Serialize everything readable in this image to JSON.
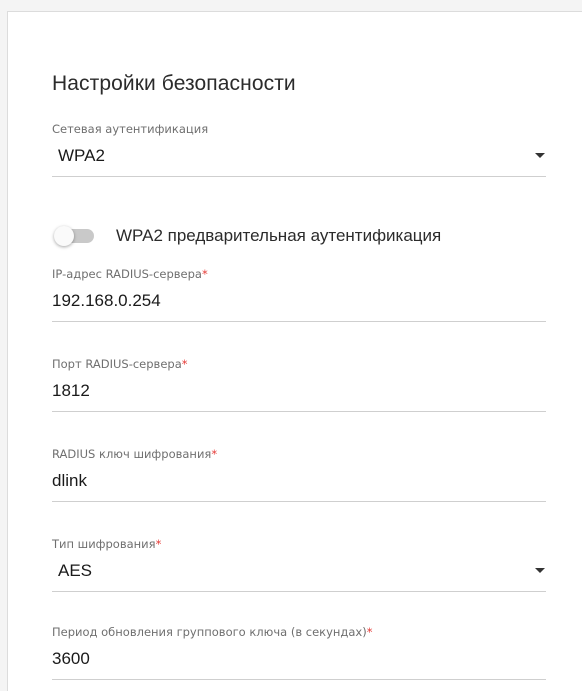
{
  "section": {
    "title": "Настройки безопасности"
  },
  "network_auth": {
    "label": "Сетевая аутентификация",
    "value": "WPA2"
  },
  "preauth_toggle": {
    "label": "WPA2 предварительная аутентификация",
    "enabled": false
  },
  "radius_ip": {
    "label": "IP-адрес RADIUS-сервера",
    "required_mark": "*",
    "value": "192.168.0.254"
  },
  "radius_port": {
    "label": "Порт RADIUS-сервера",
    "required_mark": "*",
    "value": "1812"
  },
  "radius_key": {
    "label": "RADIUS ключ шифрования",
    "required_mark": "*",
    "value": "dlink"
  },
  "encryption_type": {
    "label": "Тип шифрования",
    "required_mark": "*",
    "value": "AES"
  },
  "group_key_period": {
    "label": "Период обновления группового ключа (в секундах)",
    "required_mark": "*",
    "value": "3600"
  },
  "icons": {
    "dropdown": "chevron-down-icon"
  },
  "colors": {
    "required": "#e53935",
    "divider": "#cfcfcf",
    "toggle_off_track": "#c9c9c9"
  }
}
